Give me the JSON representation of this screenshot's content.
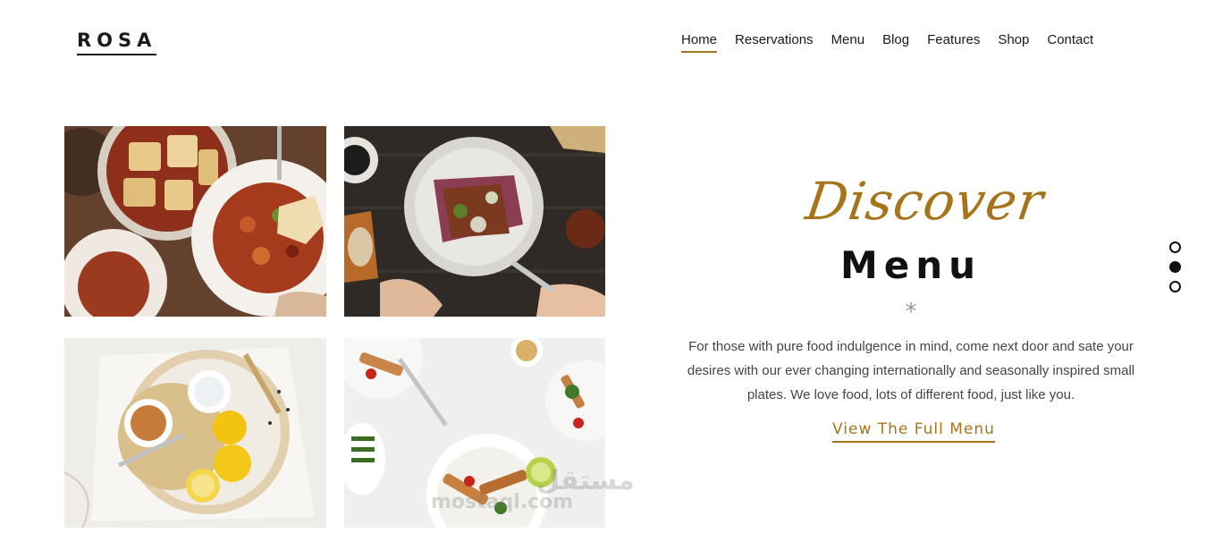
{
  "header": {
    "logo": "ROSA",
    "nav": [
      {
        "label": "Home",
        "active": true
      },
      {
        "label": "Reservations",
        "active": false
      },
      {
        "label": "Menu",
        "active": false
      },
      {
        "label": "Blog",
        "active": false
      },
      {
        "label": "Features",
        "active": false
      },
      {
        "label": "Shop",
        "active": false
      },
      {
        "label": "Contact",
        "active": false
      }
    ]
  },
  "gallery": {
    "images": [
      {
        "icon": "stew-dish-photo"
      },
      {
        "icon": "steak-salad-photo"
      },
      {
        "icon": "lemons-ingredients-photo"
      },
      {
        "icon": "chicken-salad-photo"
      }
    ]
  },
  "intro": {
    "script_title": "Discover",
    "title": "Menu",
    "divider": "*",
    "description": "For those with pure food indulgence in mind, come next door and sate your desires with our ever changing internationally and seasonally inspired small plates. We love food, lots of different food, just like you.",
    "cta_label": "View The Full Menu"
  },
  "slider": {
    "slide_count": 3,
    "active_index": 1
  },
  "watermark": {
    "arabic": "مستقل",
    "latin": "mostaql.com"
  },
  "colors": {
    "accent": "#a8741a",
    "text": "#1a1a1a",
    "muted": "#444444"
  }
}
